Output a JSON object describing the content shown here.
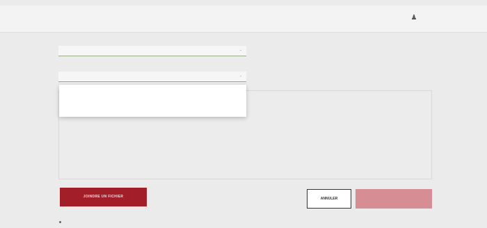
{
  "nav": {
    "links": [
      "",
      "",
      "",
      ""
    ],
    "user_icon": "user-icon"
  },
  "form": {
    "field1": {
      "label": "",
      "value": ""
    },
    "field2": {
      "label": "",
      "value": ""
    },
    "dropdown_options": [
      "",
      ""
    ],
    "message": {
      "counter": ""
    }
  },
  "actions": {
    "attach_label": "JOINDRE UN FICHIER",
    "help_lines": [
      "",
      "",
      "",
      ""
    ],
    "cancel_label": "ANNULER",
    "send_label": ""
  },
  "consent": {
    "text": ""
  },
  "colors": {
    "primary": "#a21f2a",
    "send_disabled": "#d68d94",
    "background": "#ebebeb"
  }
}
